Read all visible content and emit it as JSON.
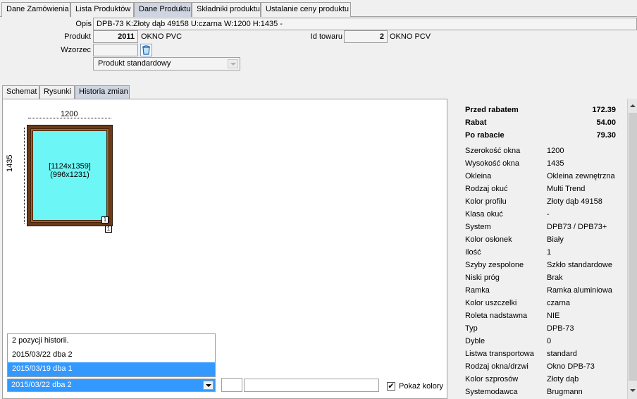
{
  "top_tabs": [
    "Dane Zamówienia",
    "Lista Produktów",
    "Dane Produktu",
    "Składniki produktu",
    "Ustalanie ceny produktu"
  ],
  "form": {
    "opis_label": "Opis",
    "opis_value": "DPB-73 K:Złoty dąb 49158 U:czarna W:1200 H:1435 -",
    "produkt_label": "Produkt",
    "produkt_id": "2011",
    "produkt_name": "OKNO PVC",
    "id_towaru_label": "Id towaru",
    "id_towaru_value": "2",
    "id_towaru_name": "OKNO PCV",
    "wzorzec_label": "Wzorzec",
    "product_type": "Produkt standardowy"
  },
  "inner_tabs": [
    "Schemat",
    "Rysunki",
    "Historia zmian"
  ],
  "drawing": {
    "width_label": "1200",
    "height_label": "1435",
    "glass_line1": "[1124x1359]",
    "glass_line2": "(996x1231)",
    "badge1": "1",
    "badge2": "1"
  },
  "history": {
    "items": [
      "2 pozycji historii.",
      "2015/03/22 dba 2",
      "2015/03/19 dba 1"
    ],
    "selected_index": 2,
    "current": "2015/03/22 dba 2"
  },
  "show_colors": {
    "label": "Pokaż kolory",
    "checked": true,
    "mark": "✔"
  },
  "prices": [
    {
      "label": "Przed rabatem",
      "value": "172.39"
    },
    {
      "label": "Rabat",
      "value": "54.00"
    },
    {
      "label": "Po rabacie",
      "value": "79.30"
    }
  ],
  "properties": [
    {
      "key": "Szerokość okna",
      "value": "1200"
    },
    {
      "key": "Wysokość okna",
      "value": "1435"
    },
    {
      "key": "Okleina",
      "value": "Okleina zewnętrzna"
    },
    {
      "key": "Rodzaj okuć",
      "value": "Multi Trend"
    },
    {
      "key": "Kolor profilu",
      "value": "Złoty dąb 49158"
    },
    {
      "key": "Klasa okuć",
      "value": "-"
    },
    {
      "key": "System",
      "value": "DPB73 / DPB73+"
    },
    {
      "key": "Kolor osłonek",
      "value": "Biały"
    },
    {
      "key": "Ilość",
      "value": "1"
    },
    {
      "key": "Szyby zespolone",
      "value": "Szkło standardowe"
    },
    {
      "key": "Niski próg",
      "value": "Brak"
    },
    {
      "key": "Ramka",
      "value": "Ramka aluminiowa"
    },
    {
      "key": "Kolor uszczelki",
      "value": "czarna"
    },
    {
      "key": "Roleta nadstawna",
      "value": "NIE"
    },
    {
      "key": "Typ",
      "value": "DPB-73"
    },
    {
      "key": "Dyble",
      "value": "0"
    },
    {
      "key": "Listwa transportowa",
      "value": "standard"
    },
    {
      "key": "Rodzaj okna/drzwi",
      "value": "Okno DPB-73"
    },
    {
      "key": "Kolor szprosów",
      "value": "Złoty dąb"
    },
    {
      "key": "Systemodawca",
      "value": "Brugmann"
    }
  ]
}
